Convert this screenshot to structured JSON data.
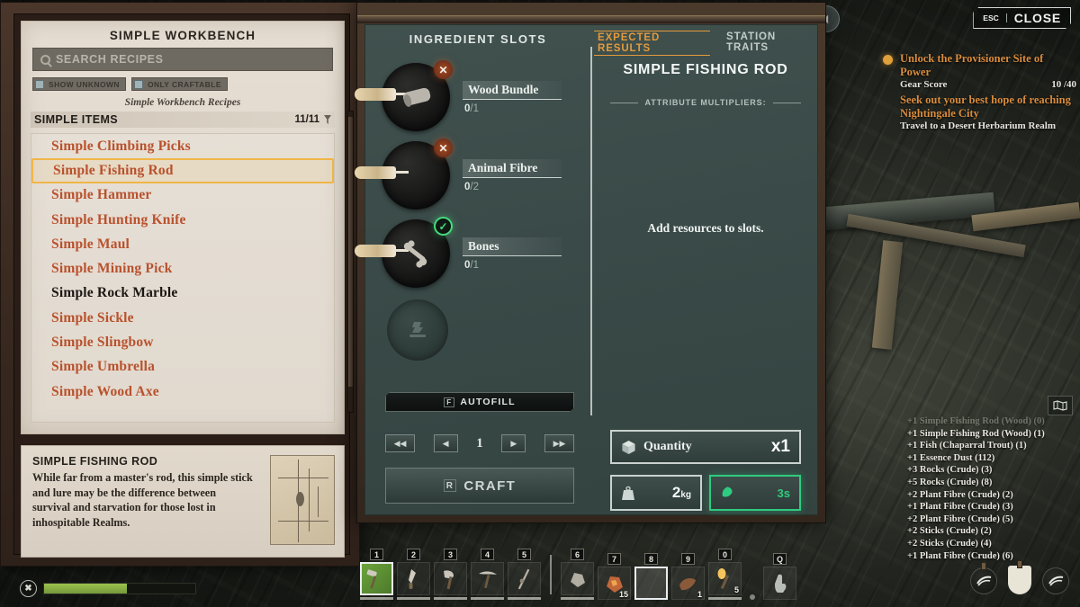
{
  "workbench": {
    "title": "SIMPLE WORKBENCH",
    "search_placeholder": "SEARCH RECIPES",
    "filters": [
      {
        "label": "SHOW UNKNOWN",
        "checked": false
      },
      {
        "label": "ONLY CRAFTABLE",
        "checked": false
      }
    ],
    "subtitle": "Simple Workbench Recipes",
    "category": {
      "name": "SIMPLE ITEMS",
      "count": "11/11"
    },
    "recipes": [
      {
        "name": "Simple Climbing Picks",
        "state": "unlocked",
        "selected": false
      },
      {
        "name": "Simple Fishing Rod",
        "state": "unlocked",
        "selected": true
      },
      {
        "name": "Simple Hammer",
        "state": "unlocked",
        "selected": false
      },
      {
        "name": "Simple Hunting Knife",
        "state": "unlocked",
        "selected": false
      },
      {
        "name": "Simple Maul",
        "state": "unlocked",
        "selected": false
      },
      {
        "name": "Simple Mining Pick",
        "state": "unlocked",
        "selected": false
      },
      {
        "name": "Simple Rock Marble",
        "state": "known",
        "selected": false
      },
      {
        "name": "Simple Sickle",
        "state": "unlocked",
        "selected": false
      },
      {
        "name": "Simple Slingbow",
        "state": "unlocked",
        "selected": false
      },
      {
        "name": "Simple Umbrella",
        "state": "unlocked",
        "selected": false
      },
      {
        "name": "Simple Wood Axe",
        "state": "unlocked",
        "selected": false
      }
    ]
  },
  "description": {
    "title": "SIMPLE FISHING ROD",
    "body": "While far from a master's rod, this simple stick and lure may be the difference between survival and starvation for those lost in inhospitable Realms."
  },
  "craft": {
    "ingredients_title": "INGREDIENT SLOTS",
    "slots": [
      {
        "name": "Wood Bundle",
        "have": "0",
        "need": "/1",
        "status": "missing",
        "icon": "wood-bundle-icon"
      },
      {
        "name": "Animal Fibre",
        "have": "0",
        "need": "/2",
        "status": "missing",
        "icon": "animal-fibre-icon"
      },
      {
        "name": "Bones",
        "have": "0",
        "need": "/1",
        "status": "ok",
        "icon": "bones-icon"
      },
      {
        "name": "",
        "have": "",
        "need": "",
        "status": "locked",
        "icon": "locked-slot-icon"
      }
    ],
    "autofill": {
      "key": "F",
      "label": "AUTOFILL"
    },
    "quantity_value": "1",
    "craft_button": {
      "key": "R",
      "label": "CRAFT"
    },
    "nav": {
      "first": "◀◀",
      "prev": "◀",
      "next": "▶",
      "last": "▶▶"
    }
  },
  "results": {
    "tabs": [
      {
        "label": "EXPECTED RESULTS",
        "active": true
      },
      {
        "label": "STATION TRAITS",
        "active": false
      }
    ],
    "item_name": "SIMPLE FISHING ROD",
    "attribute_header": "ATTRIBUTE MULTIPLIERS:",
    "empty_message": "Add resources to slots.",
    "quantity": {
      "label": "Quantity",
      "value": "x1"
    },
    "weight": {
      "value": "2",
      "unit": "kg"
    },
    "time": {
      "value": "3s"
    }
  },
  "topbar": {
    "close": {
      "key": "ESC",
      "label": "CLOSE"
    },
    "back_icon": "back-arrow-icon"
  },
  "quests": [
    {
      "title": "Unlock the Provisioner Site of Power",
      "objective": "Gear Score",
      "progress": "10 /40"
    },
    {
      "title": "Seek out your best hope of reaching Nightingale City",
      "objective": "Travel to a Desert Herbarium Realm",
      "progress": ""
    }
  ],
  "loot_log": [
    "+1 Simple Fishing Rod (Wood) (0)",
    "+1 Simple Fishing Rod (Wood) (1)",
    "+1 Fish (Chaparral Trout) (1)",
    "+1 Essence Dust (112)",
    "+3 Rocks (Crude) (3)",
    "+5 Rocks (Crude) (8)",
    "+2 Plant Fibre (Crude) (2)",
    "+1 Plant Fibre (Crude) (3)",
    "+2 Plant Fibre (Crude) (5)",
    "+2 Sticks (Crude) (2)",
    "+2 Sticks (Crude) (4)",
    "+1 Plant Fibre (Crude) (6)"
  ],
  "hotbar": [
    {
      "key": "1",
      "icon": "hammer-icon",
      "count": "",
      "selected": true,
      "highlight": true,
      "durability": true
    },
    {
      "key": "2",
      "icon": "knife-icon",
      "count": "",
      "selected": false,
      "highlight": false,
      "durability": true
    },
    {
      "key": "3",
      "icon": "axe-icon",
      "count": "",
      "selected": false,
      "highlight": false,
      "durability": true
    },
    {
      "key": "4",
      "icon": "pickaxe-icon",
      "count": "",
      "selected": false,
      "highlight": false,
      "durability": true
    },
    {
      "key": "5",
      "icon": "fishing-rod-icon",
      "count": "",
      "selected": false,
      "highlight": false,
      "durability": true
    },
    {
      "key": "6",
      "icon": "rock-icon",
      "count": "",
      "selected": false,
      "highlight": false,
      "durability": true
    },
    {
      "key": "7",
      "icon": "ore-icon",
      "count": "15",
      "selected": false,
      "highlight": false,
      "durability": false
    },
    {
      "key": "8",
      "icon": "empty-slot-icon",
      "count": "",
      "selected": true,
      "highlight": false,
      "durability": false
    },
    {
      "key": "9",
      "icon": "meat-icon",
      "count": "1",
      "selected": false,
      "highlight": false,
      "durability": false
    },
    {
      "key": "0",
      "icon": "torch-icon",
      "count": "5",
      "selected": false,
      "highlight": false,
      "durability": true
    },
    {
      "key": "Q",
      "icon": "hand-icon",
      "count": "",
      "selected": false,
      "highlight": false,
      "durability": false
    }
  ],
  "vitals": {
    "stamina_icon": "stamina-icon",
    "stamina_percent": 55
  },
  "status_icons": [
    {
      "name": "swiftness-buff-icon"
    },
    {
      "name": "shield-buff-icon"
    },
    {
      "name": "swiftness-buff-icon-2"
    }
  ],
  "colors": {
    "accent_orange": "#d98c3d",
    "recipe_red": "#b9512c",
    "selection_yellow": "#f0b648",
    "panel_teal": "#3a4a48",
    "time_green": "#2ecc80",
    "parchment": "#e6ded3"
  }
}
